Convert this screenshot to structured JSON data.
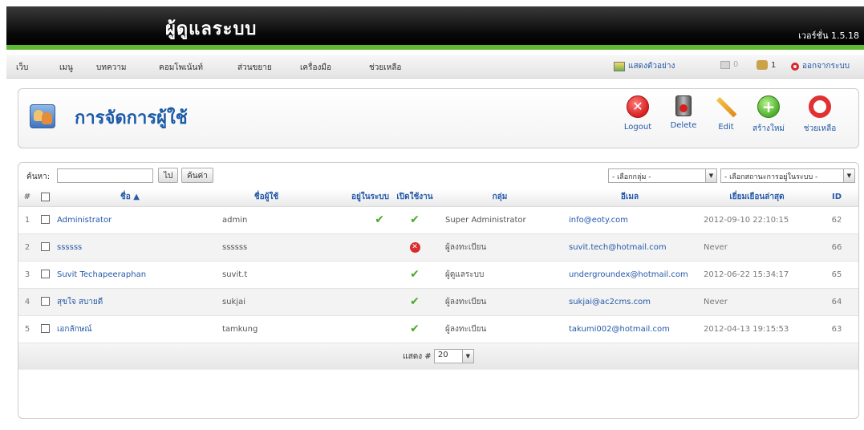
{
  "header": {
    "title": "ผู้ดูแลระบบ",
    "version": "เวอร์ชั่น 1.5.18"
  },
  "menu": [
    "เว็บ",
    "เมนู",
    "บทความ",
    "คอมโพเน้นท์",
    "ส่วนขยาย",
    "เครื่องมือ",
    "ช่วยเหลือ"
  ],
  "status": {
    "preview": "แสดงตัวอย่าง",
    "messages": "0",
    "users_online": "1",
    "logout": "ออกจากระบบ"
  },
  "page": {
    "title": "การจัดการผู้ใช้"
  },
  "toolbar": {
    "logout": "Logout",
    "delete": "Delete",
    "edit": "Edit",
    "new": "สร้างใหม่",
    "help": "ช่วยเหลือ"
  },
  "filter": {
    "label": "ค้นหา:",
    "value": "",
    "go": "ไป",
    "reset": "ค้นค่า",
    "group_select": "- เลือกกลุ่ม -",
    "status_select": "- เลือกสถานะการอยู่ในระบบ -"
  },
  "columns": {
    "num": "#",
    "name": "ชื่อ",
    "username": "ชื่อผู้ใช้",
    "logged_in": "อยู่ในระบบ",
    "enabled": "เปิดใช้งาน",
    "group": "กลุ่ม",
    "email": "อีเมล",
    "last_visit": "เยี่ยมเยือนล่าสุด",
    "id": "ID"
  },
  "rows": [
    {
      "num": "1",
      "name": "Administrator",
      "username": "admin",
      "logged_in": true,
      "enabled": true,
      "group": "Super Administrator",
      "email": "info@eoty.com",
      "last_visit": "2012-09-10 22:10:15",
      "id": "62"
    },
    {
      "num": "2",
      "name": "ssssss",
      "username": "ssssss",
      "logged_in": false,
      "enabled": false,
      "group": "ผู้ลงทะเบียน",
      "email": "suvit.tech@hotmail.com",
      "last_visit": "Never",
      "id": "66"
    },
    {
      "num": "3",
      "name": "Suvit Techapeeraphan",
      "username": "suvit.t",
      "logged_in": false,
      "enabled": true,
      "group": "ผู้ดูแลระบบ",
      "email": "undergroundex@hotmail.com",
      "last_visit": "2012-06-22 15:34:17",
      "id": "65"
    },
    {
      "num": "4",
      "name": "สุขใจ สบายดี",
      "username": "sukjai",
      "logged_in": false,
      "enabled": true,
      "group": "ผู้ลงทะเบียน",
      "email": "sukjai@ac2cms.com",
      "last_visit": "Never",
      "id": "64"
    },
    {
      "num": "5",
      "name": "เอกลักษณ์",
      "username": "tamkung",
      "logged_in": false,
      "enabled": true,
      "group": "ผู้ลงทะเบียน",
      "email": "takumi002@hotmail.com",
      "last_visit": "2012-04-13 19:15:53",
      "id": "63"
    }
  ],
  "pager": {
    "label": "แสดง #",
    "value": "20"
  }
}
